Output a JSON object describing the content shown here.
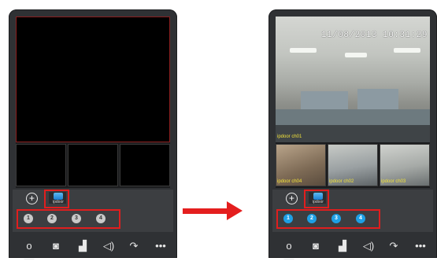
{
  "left_phone": {
    "door_label": "ipdoor",
    "channels": [
      "1",
      "2",
      "3",
      "4"
    ]
  },
  "right_phone": {
    "timestamp": "11/08/2013 10:31:29",
    "main_camera_label": "ipdoor ch01",
    "thumbnails": [
      "ipdoor ch04",
      "ipdoor ch02",
      "ipdoor ch03"
    ],
    "door_label": "ipdoor",
    "channels": [
      "1",
      "2",
      "3",
      "4"
    ]
  },
  "controls": {
    "add_symbol": "+",
    "toolbar_icons": [
      "key-icon",
      "camera-icon",
      "video-record-icon",
      "speaker-icon",
      "phone-handset-icon",
      "more-icon"
    ],
    "toolbar_glyphs": [
      "o—",
      "◙",
      "▟",
      "◁)",
      "↷",
      "•••"
    ]
  },
  "colors": {
    "highlight": "#e01e1e",
    "channel_active": "#1ea0e6",
    "channel_inactive": "#c9c9c9",
    "cam_label": "#f2e23a"
  }
}
